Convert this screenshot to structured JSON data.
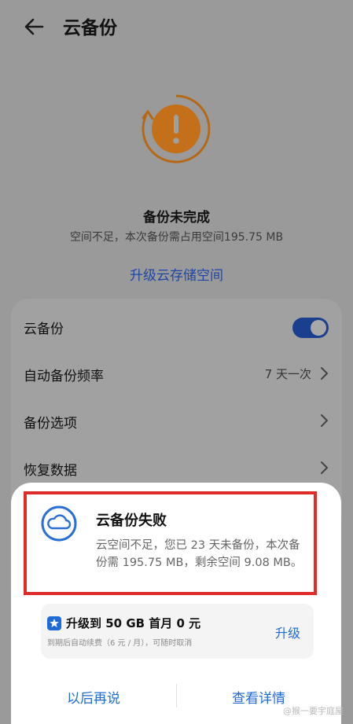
{
  "header": {
    "title": "云备份"
  },
  "status": {
    "title": "备份未完成",
    "subtitle": "空间不足，本次备份需占用空间195.75 MB",
    "upgrade_link": "升级云存储空间",
    "accent_color": "#e5891f"
  },
  "settings": {
    "rows": [
      {
        "label": "云备份",
        "toggle_on": true
      },
      {
        "label": "自动备份频率",
        "value": "7 天一次"
      },
      {
        "label": "备份选项"
      },
      {
        "label": "恢复数据"
      }
    ]
  },
  "dialog": {
    "title": "云备份失败",
    "message": "云空间不足，您已 23 天未备份，本次备份需 195.75 MB，剩余空间 9.08 MB。",
    "promo": {
      "title": "升级到 50 GB 首月 0 元",
      "note": "到期后自动续费（6 元 / 月），可随时取消",
      "button": "升级"
    },
    "later_button": "以后再说",
    "details_button": "查看详情",
    "highlight_color": "#e02b2b"
  },
  "watermark": "@猴一要宇庭屋"
}
